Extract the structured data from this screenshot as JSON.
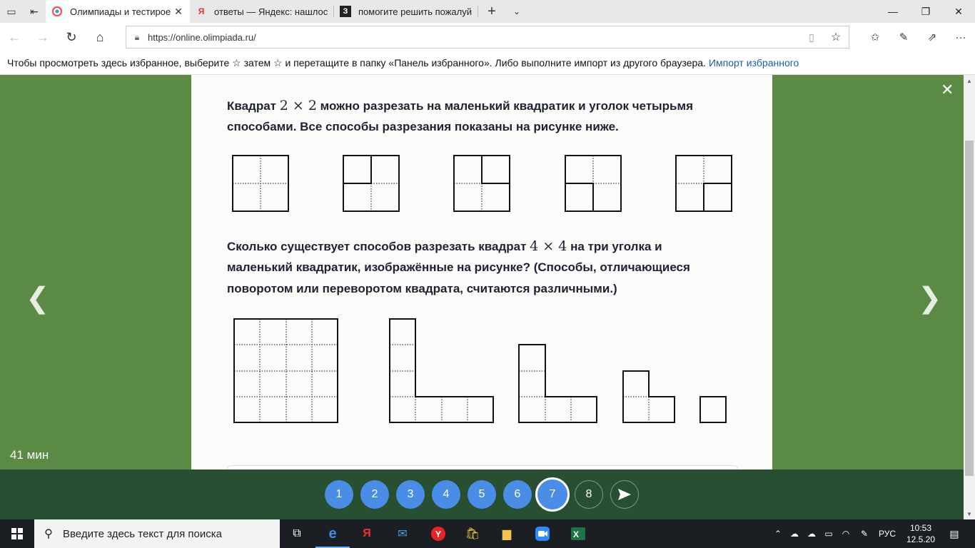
{
  "browser": {
    "tabs": [
      {
        "title": "Олимпиады и тестирое",
        "favicon": "olimpiada-logo",
        "active": true
      },
      {
        "title": "ответы — Яндекс: нашлось",
        "favicon": "yandex-icon",
        "active": false
      },
      {
        "title": "помогите решить пожалуй",
        "favicon": "znanija-icon",
        "active": false
      }
    ],
    "url": "https://online.olimpiada.ru/",
    "favorites_hint": "Чтобы просмотреть здесь избранное, выберите  ☆  затем ☆ и перетащите в папку «Панель избранного». Либо выполните импорт из другого браузера.",
    "import_link": "Импорт избранного"
  },
  "question": {
    "intro_line1_a": "Квадрат",
    "intro_math1": "2 × 2",
    "intro_line1_b": "можно разрезать на маленький квадратик и уголок четырьмя",
    "intro_line2": "способами. Все способы разрезания показаны на рисунке ниже.",
    "q_line1_a": "Сколько существует способов разрезать квадрат",
    "q_math": "4 × 4",
    "q_line1_b": "на три уголка и",
    "q_line2": "маленький квадратик, изображённые на рисунке? (Способы, отличающиеся",
    "q_line3": "поворотом или переворотом квадрата, считаются различными.)"
  },
  "timer": "41 мин",
  "pager": {
    "items": [
      "1",
      "2",
      "3",
      "4",
      "5",
      "6",
      "7",
      "8"
    ],
    "current": "7",
    "send_icon": "send-arrow-icon"
  },
  "taskbar": {
    "search_placeholder": "Введите здесь текст для поиска",
    "lang": "РУС",
    "time": "10:53",
    "date": "12.5.20"
  }
}
